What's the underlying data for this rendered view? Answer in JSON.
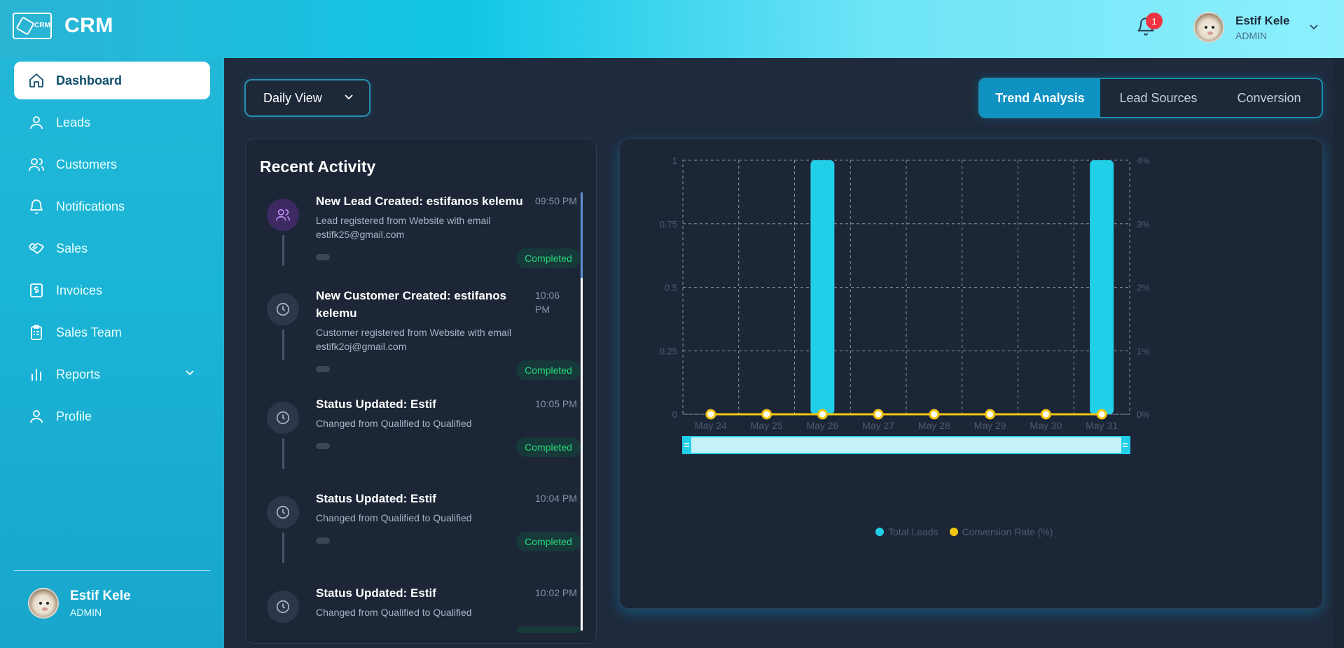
{
  "app": {
    "logo_mark_text": "CRM",
    "name": "CRM"
  },
  "header": {
    "notification_count": "1",
    "user": {
      "name": "Estif Kele",
      "role": "ADMIN"
    }
  },
  "sidebar": {
    "items": [
      {
        "label": "Dashboard",
        "icon": "home-icon",
        "active": true
      },
      {
        "label": "Leads",
        "icon": "user-icon"
      },
      {
        "label": "Customers",
        "icon": "users-icon"
      },
      {
        "label": "Notifications",
        "icon": "bell-icon"
      },
      {
        "label": "Sales",
        "icon": "handshake-icon"
      },
      {
        "label": "Invoices",
        "icon": "invoice-icon"
      },
      {
        "label": "Sales Team",
        "icon": "clipboard-icon"
      },
      {
        "label": "Reports",
        "icon": "bar-chart-icon",
        "has_submenu": true
      },
      {
        "label": "Profile",
        "icon": "user-icon"
      }
    ],
    "user": {
      "name": "Estif Kele",
      "role": "ADMIN"
    }
  },
  "main": {
    "view_select": {
      "value": "Daily View"
    },
    "tabs": [
      {
        "label": "Trend Analysis",
        "active": true
      },
      {
        "label": "Lead Sources"
      },
      {
        "label": "Conversion"
      }
    ],
    "activity": {
      "title": "Recent Activity",
      "items": [
        {
          "title": "New Lead Created: estifanos kelemu",
          "time": "09:50 PM",
          "desc": "Lead registered from Website with email estifk25@gmail.com",
          "status": "Completed",
          "icon": "users-icon"
        },
        {
          "title": "New Customer Created: estifanos kelemu",
          "time": "10:06 PM",
          "desc": "Customer registered from Website with email estifk2oj@gmail.com",
          "status": "Completed",
          "icon": "clock-icon"
        },
        {
          "title": "Status Updated: Estif",
          "time": "10:05 PM",
          "desc": "Changed from Qualified to Qualified",
          "status": "Completed",
          "icon": "clock-icon"
        },
        {
          "title": "Status Updated: Estif",
          "time": "10:04 PM",
          "desc": "Changed from Qualified to Qualified",
          "status": "Completed",
          "icon": "clock-icon"
        },
        {
          "title": "Status Updated: Estif",
          "time": "10:02 PM",
          "desc": "Changed from Qualified to Qualified",
          "status": "Completed",
          "icon": "clock-icon"
        }
      ]
    }
  },
  "chart_data": {
    "type": "bar",
    "categories": [
      "May 24",
      "May 25",
      "May 26",
      "May 27",
      "May 28",
      "May 29",
      "May 30",
      "May 31"
    ],
    "series": [
      {
        "name": "Total Leads",
        "kind": "bar",
        "axis": "left",
        "color": "#22cfe8",
        "values": [
          0,
          0,
          1,
          0,
          0,
          0,
          0,
          1
        ]
      },
      {
        "name": "Conversion Rate (%)",
        "kind": "line",
        "axis": "right",
        "color": "#f2c511",
        "values": [
          0,
          0,
          0,
          0,
          0,
          0,
          0,
          0
        ]
      }
    ],
    "y_left": {
      "ticks": [
        "0",
        "0.25",
        "0.5",
        "0.75",
        "1"
      ],
      "range": [
        0,
        1
      ]
    },
    "y_right": {
      "ticks": [
        "0%",
        "1%",
        "2%",
        "3%",
        "4%"
      ],
      "range": [
        0,
        4
      ]
    },
    "grid": true,
    "legend": "bottom-center",
    "zoom_slider": true
  },
  "colors": {
    "accent": "#12c7e6",
    "active_tab": "#0f91c2",
    "status_green": "#27d87a",
    "panel_bg": "#1c2636"
  }
}
